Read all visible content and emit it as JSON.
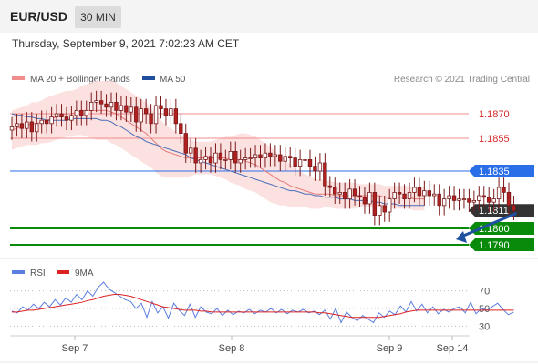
{
  "header": {
    "pair": "EUR/USD",
    "timeframe": "30 MIN"
  },
  "datetime": "Thursday, September 9, 2021 7:02:23 AM CET",
  "legend": {
    "items": [
      {
        "label": "MA 20 + Bollinger Bands",
        "color": "#f08c8c"
      },
      {
        "label": "MA 50",
        "color": "#1f4e9c"
      }
    ]
  },
  "copyright": "Research © 2021 Trading Central",
  "colors": {
    "up": "#ffffff",
    "down": "#b02020",
    "resistance": "#f08c8c",
    "pivot": "#2a6ee8",
    "support": "#0a8a0a",
    "last": "#333333",
    "ma50": "#4a6eb8",
    "band": "#fbdcdc",
    "arrow": "#2050a0"
  },
  "chart_data": [
    {
      "type": "candlestick",
      "ylim": [
        1.1785,
        1.1885
      ],
      "x_ticks": [
        "Sep 7",
        "Sep 8",
        "Sep 9",
        "Sep 14"
      ],
      "levels": [
        {
          "label": "1.1870",
          "value": 1.187,
          "kind": "resistance"
        },
        {
          "label": "1.1855",
          "value": 1.1855,
          "kind": "resistance"
        },
        {
          "label": "1.1835",
          "value": 1.1835,
          "kind": "pivot"
        },
        {
          "label": "1.1811",
          "value": 1.1811,
          "kind": "last"
        },
        {
          "label": "1.1800",
          "value": 1.18,
          "kind": "support"
        },
        {
          "label": "1.1790",
          "value": 1.179,
          "kind": "support"
        }
      ],
      "close": [
        1.1862,
        1.1864,
        1.1861,
        1.1865,
        1.1859,
        1.1864,
        1.1866,
        1.1864,
        1.1868,
        1.187,
        1.1868,
        1.1866,
        1.1869,
        1.1872,
        1.1869,
        1.1872,
        1.1877,
        1.1878,
        1.1876,
        1.1874,
        1.1877,
        1.1872,
        1.1875,
        1.1871,
        1.1874,
        1.1865,
        1.1873,
        1.187,
        1.1864,
        1.1875,
        1.1873,
        1.1869,
        1.1873,
        1.1864,
        1.1858,
        1.1846,
        1.1849,
        1.184,
        1.1842,
        1.1844,
        1.184,
        1.1846,
        1.1842,
        1.1842,
        1.1847,
        1.184,
        1.1842,
        1.1843,
        1.1843,
        1.1845,
        1.1843,
        1.1846,
        1.1844,
        1.1845,
        1.1841,
        1.1844,
        1.1843,
        1.1838,
        1.1842,
        1.1842,
        1.1838,
        1.1835,
        1.184,
        1.1826,
        1.1825,
        1.1821,
        1.1822,
        1.1818,
        1.1824,
        1.182,
        1.1819,
        1.1815,
        1.1822,
        1.1808,
        1.1814,
        1.181,
        1.1818,
        1.1822,
        1.1821,
        1.1818,
        1.1822,
        1.1825,
        1.182,
        1.1823,
        1.182,
        1.1821,
        1.1814,
        1.1818,
        1.182,
        1.1817,
        1.1818,
        1.1818,
        1.1816,
        1.1817,
        1.182,
        1.1819,
        1.1816,
        1.1818,
        1.1825,
        1.1822,
        1.1814,
        1.1811
      ],
      "ma20": [
        1.186,
        1.1861,
        1.1862,
        1.1863,
        1.1864,
        1.1864,
        1.1865,
        1.1866,
        1.1867,
        1.1868,
        1.1869,
        1.187,
        1.187,
        1.1871,
        1.1872,
        1.1872,
        1.1872,
        1.1872,
        1.1872,
        1.1872,
        1.1871,
        1.187,
        1.1868,
        1.1866,
        1.1864,
        1.1862,
        1.186,
        1.1858,
        1.1855,
        1.1852,
        1.1849,
        1.1847,
        1.1846,
        1.1845,
        1.1844,
        1.1843,
        1.1843,
        1.1843,
        1.1843,
        1.1843,
        1.1843,
        1.1843,
        1.1843,
        1.1843,
        1.1842,
        1.1842,
        1.1842,
        1.1841,
        1.184,
        1.1839,
        1.1837,
        1.1835,
        1.1833,
        1.1831,
        1.1829,
        1.1828,
        1.1826,
        1.1825,
        1.1824,
        1.1823,
        1.1822,
        1.1821,
        1.1821,
        1.1821,
        1.1821,
        1.182,
        1.182,
        1.182,
        1.182,
        1.182,
        1.182,
        1.182,
        1.182,
        1.182,
        1.182,
        1.1819,
        1.1819,
        1.1819,
        1.1819,
        1.1819,
        1.1819,
        1.1818,
        1.1818,
        1.1818
      ],
      "ma50": [
        1.187,
        1.1869,
        1.1869,
        1.1868,
        1.1868,
        1.1867,
        1.1867,
        1.1866,
        1.1866,
        1.1866,
        1.1866,
        1.1866,
        1.1867,
        1.1867,
        1.1867,
        1.1867,
        1.1867,
        1.1867,
        1.1866,
        1.1866,
        1.1865,
        1.1863,
        1.1862,
        1.186,
        1.1858,
        1.1856,
        1.1855,
        1.1853,
        1.1852,
        1.1851,
        1.185,
        1.1849,
        1.1848,
        1.1847,
        1.1846,
        1.1845,
        1.1843,
        1.1842,
        1.1841,
        1.184,
        1.1839,
        1.1838,
        1.1837,
        1.1836,
        1.1835,
        1.1834,
        1.1833,
        1.1832,
        1.1831,
        1.183,
        1.1829,
        1.1828,
        1.1827,
        1.1826,
        1.1825,
        1.1824,
        1.1823,
        1.1823,
        1.1822,
        1.1821,
        1.1821,
        1.182,
        1.182,
        1.1819,
        1.1819,
        1.1819,
        1.1818,
        1.1818,
        1.1818,
        1.1817,
        1.1817,
        1.1817,
        1.1817,
        1.1816,
        1.1816,
        1.1815,
        1.1815,
        1.1815,
        1.1814,
        1.1814,
        1.1814,
        1.1814,
        1.1814,
        1.1814
      ],
      "band_width": [
        0.0012,
        0.0012,
        0.0012,
        0.0012,
        0.0013,
        0.0013,
        0.0013,
        0.0014,
        0.0014,
        0.0014,
        0.0014,
        0.0014,
        0.0014,
        0.0014,
        0.0015,
        0.0016,
        0.0017,
        0.0018,
        0.0018,
        0.0018,
        0.0019,
        0.0019,
        0.0019,
        0.0019,
        0.0019,
        0.0019,
        0.0019,
        0.0019,
        0.0018,
        0.0018,
        0.0017,
        0.0016,
        0.0015,
        0.0014,
        0.0013,
        0.0012,
        0.0011,
        0.001,
        0.001,
        0.001,
        0.001,
        0.0011,
        0.0012,
        0.0013,
        0.0014,
        0.0015,
        0.0016,
        0.0017,
        0.0017,
        0.0017,
        0.0017,
        0.0017,
        0.0017,
        0.0016,
        0.0015,
        0.0014,
        0.0013,
        0.0012,
        0.0011,
        0.001,
        0.001,
        0.0009,
        0.0009,
        0.0008,
        0.0008,
        0.0008,
        0.0008,
        0.0008,
        0.0008,
        0.0008,
        0.0007,
        0.0007,
        0.0007,
        0.0007,
        0.0007,
        0.0007,
        0.0007,
        0.0007,
        0.0007,
        0.0007,
        0.0007,
        0.0007,
        0.0007,
        0.0007
      ],
      "forecast_arrow": {
        "to": 1.179
      }
    },
    {
      "type": "line",
      "ylim": [
        20,
        80
      ],
      "y_ticks": [
        70,
        50,
        30
      ],
      "series": [
        {
          "name": "RSI",
          "color": "#5b7fe0",
          "values": [
            47,
            45,
            52,
            48,
            55,
            50,
            57,
            52,
            60,
            54,
            62,
            57,
            66,
            60,
            70,
            64,
            74,
            80,
            72,
            68,
            64,
            60,
            58,
            50,
            56,
            40,
            58,
            45,
            52,
            39,
            56,
            48,
            42,
            55,
            40,
            52,
            46,
            44,
            50,
            42,
            48,
            43,
            47,
            45,
            49,
            44,
            48,
            46,
            50,
            45,
            49,
            44,
            48,
            46,
            49,
            45,
            47,
            43,
            48,
            38,
            50,
            34,
            46,
            40,
            36,
            42,
            38,
            34,
            45,
            40,
            47,
            43,
            53,
            46,
            58,
            47,
            55,
            45,
            52,
            44,
            49,
            46,
            50,
            52,
            45,
            57,
            44,
            50,
            48,
            52,
            56,
            49,
            43,
            46
          ]
        },
        {
          "name": "9MA",
          "color": "#dd2222",
          "values": [
            46,
            46,
            47,
            48,
            48,
            49,
            50,
            51,
            52,
            53,
            54,
            55,
            56,
            57,
            59,
            60,
            62,
            64,
            65,
            66,
            66,
            65,
            64,
            62,
            60,
            58,
            56,
            54,
            52,
            51,
            50,
            49,
            48,
            48,
            48,
            47,
            47,
            46,
            46,
            46,
            46,
            46,
            46,
            46,
            46,
            46,
            46,
            46,
            46,
            46,
            46,
            46,
            46,
            46,
            46,
            46,
            46,
            45,
            45,
            44,
            43,
            42,
            41,
            40,
            40,
            40,
            40,
            40,
            40,
            41,
            42,
            43,
            44,
            46,
            47,
            48,
            48,
            48,
            48,
            48,
            48,
            48,
            48,
            48,
            48,
            48,
            48,
            48,
            48,
            48,
            48,
            48,
            48,
            48
          ]
        }
      ]
    }
  ]
}
